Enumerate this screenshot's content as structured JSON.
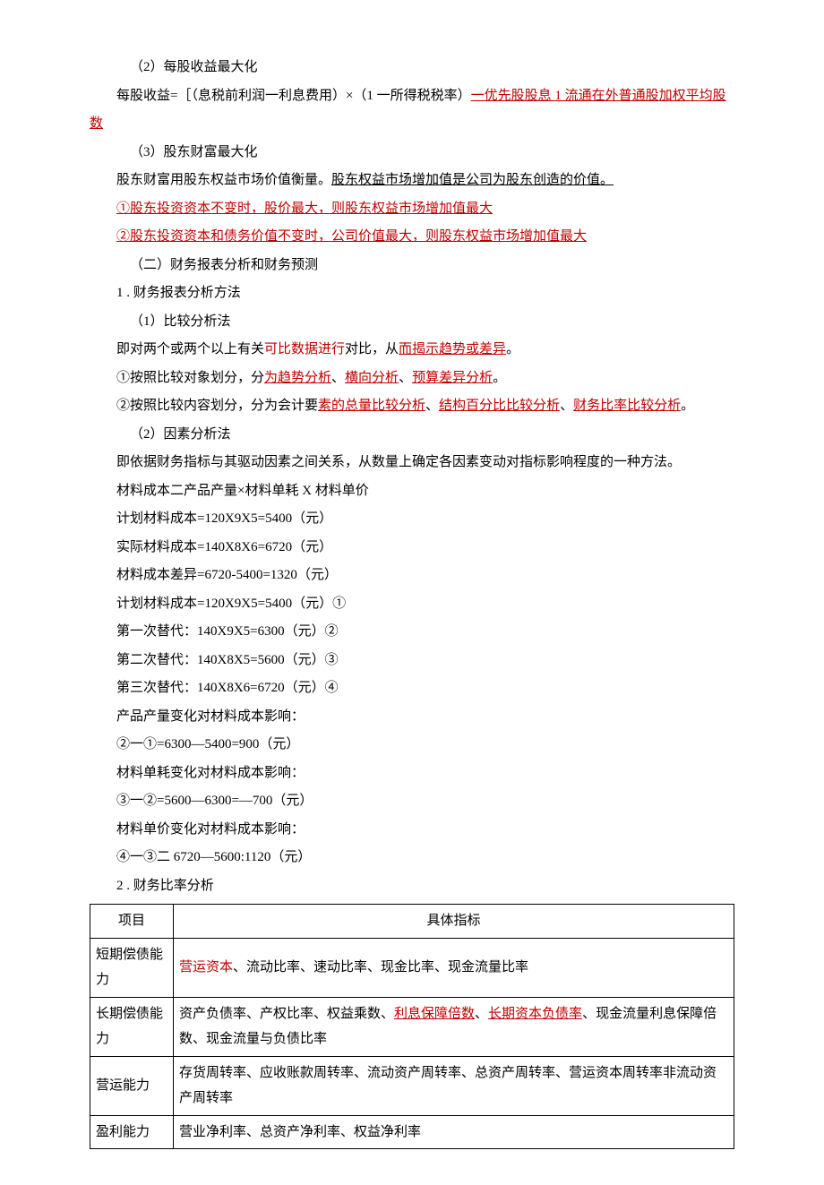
{
  "p1": "（2）每股收益最大化",
  "p2a": "每股收益=［（息税前利润一利息费用）×（1 一所得税税率）",
  "p2b": "一优先股股息 1 流通在外普通股加权平均股数",
  "p3": "（3）股东财富最大化",
  "p4a": "股东财富用股东权益市场价值衡量。",
  "p4b": "股东权益市场增加值是公司为股东创造的价值。",
  "p5": "①股东投资资本不变时，股价最大，则股东权益市场增加值最大",
  "p6": "②股东投资资本和债务价值不变时，公司价值最大，则股东权益市场增加值最大",
  "p7": "（二）财务报表分析和财务预测",
  "p8": "1  . 财务报表分析方法",
  "p9": "（1）比较分析法",
  "p10a": "即对两个或两个以上有关",
  "p10b": "可比数据进行",
  "p10c": "对比，从",
  "p10d": "而揭示趋势或差异",
  "p10e": "。",
  "p11a": "①按照比较对象划分，分",
  "p11b": "为趋势分析",
  "p11c": "、",
  "p11d": "横向分析",
  "p11e": "、",
  "p11f": "预算差异分析",
  "p11g": "。",
  "p12a": "②按照比较内容划分，分为会计要",
  "p12b": "素的总量比较分析",
  "p12c": "、",
  "p12d": "结构百分比比较分析",
  "p12e": "、",
  "p12f": "财务比率比较分析",
  "p12g": "。",
  "p13": "（2）因素分析法",
  "p14": "即依据财务指标与其驱动因素之间关系，从数量上确定各因素变动对指标影响程度的一种方法。",
  "p15": "材料成本二产品产量×材料单耗 X 材料单价",
  "p16": "计划材料成本=120X9X5=5400（元）",
  "p17": "实际材料成本=140X8X6=6720（元）",
  "p18": "材料成本差异=6720-5400=1320（元）",
  "p19": "计划材料成本=120X9X5=5400（元）①",
  "p20": "第一次替代：140X9X5=6300（元）②",
  "p21": "第二次替代：140X8X5=5600（元）③",
  "p22": "第三次替代：140X8X6=6720（元）④",
  "p23": "产品产量变化对材料成本影响：",
  "p24": "②一①=6300—5400=900（元）",
  "p25": "材料单耗变化对材料成本影响：",
  "p26": "③一②=5600—6300=—700（元）",
  "p27": "材料单价变化对材料成本影响：",
  "p28": "④一③二 6720—5600:1120（元）",
  "p29": "2  . 财务比率分析",
  "table": {
    "header": {
      "c1": "项目",
      "c2": "具体指标"
    },
    "rows": [
      {
        "c1": "短期偿债能力",
        "c2a": "营运资本",
        "c2b": "、流动比率、速动比率、现金比率、现金流量比率"
      },
      {
        "c1": "长期偿债能力",
        "c2a": "资产负债率、产权比率、权益乘数、",
        "c2b": "利息保障倍数",
        "c2c": "、",
        "c2d": "长期资本负债率",
        "c2e": "、现金流量利息保障倍数、现金流量与负债比率"
      },
      {
        "c1": "营运能力",
        "c2": "存货周转率、应收账款周转率、流动资产周转率、总资产周转率、营运资本周转率非流动资产周转率"
      },
      {
        "c1": "盈利能力",
        "c2": "营业净利率、总资产净利率、权益净利率"
      }
    ]
  }
}
